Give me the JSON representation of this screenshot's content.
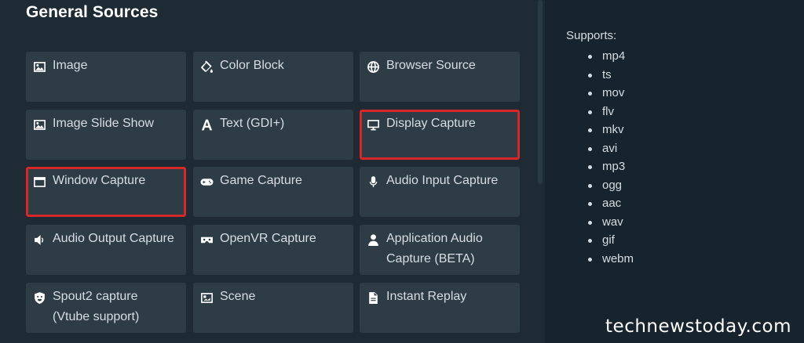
{
  "section": {
    "title": "General Sources"
  },
  "sources": [
    {
      "label": "Image",
      "icon": "image-icon"
    },
    {
      "label": "Color Block",
      "icon": "paint-bucket-icon"
    },
    {
      "label": "Browser Source",
      "icon": "globe-icon"
    },
    {
      "label": "Image Slide Show",
      "icon": "image-icon"
    },
    {
      "label": "Text (GDI+)",
      "icon": "text-a-icon"
    },
    {
      "label": "Display Capture",
      "icon": "monitor-icon",
      "highlighted": true
    },
    {
      "label": "Window Capture",
      "icon": "window-icon",
      "highlighted": true
    },
    {
      "label": "Game Capture",
      "icon": "gamepad-icon"
    },
    {
      "label": "Audio Input Capture",
      "icon": "microphone-icon"
    },
    {
      "label": "Audio Output Capture",
      "icon": "speaker-icon"
    },
    {
      "label": "OpenVR Capture",
      "icon": "vr-headset-icon"
    },
    {
      "label": "Application Audio\nCapture (BETA)",
      "icon": "user-icon"
    },
    {
      "label": "Spout2 capture\n(Vtube support)",
      "icon": "shield-icon"
    },
    {
      "label": "Scene",
      "icon": "scene-icon"
    },
    {
      "label": "Instant Replay",
      "icon": "file-icon"
    }
  ],
  "highlight_color": "#d62828",
  "supports": {
    "title": "Supports:",
    "formats": [
      "mp4",
      "ts",
      "mov",
      "flv",
      "mkv",
      "avi",
      "mp3",
      "ogg",
      "aac",
      "wav",
      "gif",
      "webm"
    ]
  },
  "watermark": "technewstoday.com"
}
